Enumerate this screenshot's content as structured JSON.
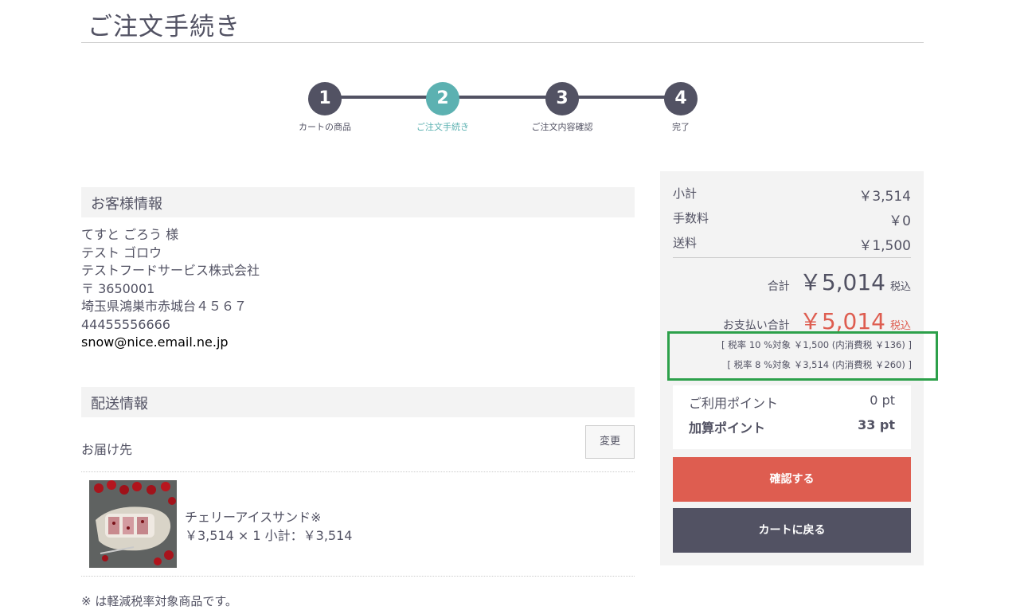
{
  "page": {
    "title": "ご注文手続き"
  },
  "flow": {
    "steps": [
      {
        "number": "1",
        "label": "カートの商品"
      },
      {
        "number": "2",
        "label": "ご注文手続き"
      },
      {
        "number": "3",
        "label": "ご注文内容確認"
      },
      {
        "number": "4",
        "label": "完了"
      }
    ],
    "active_step": 2,
    "active_color": "#5cb1b1",
    "inactive_color": "#525263"
  },
  "customer": {
    "heading": "お客様情報",
    "name_kana_honorific": "てすと ごろう 様",
    "name_katakana": "テスト ゴロウ",
    "company": "テストフードサービス株式会社",
    "postal": "〒 3650001",
    "address": "埼玉県鴻巣市赤城台４５６７",
    "phone": "44455556666",
    "email": "snow@nice.email.ne.jp"
  },
  "shipping": {
    "heading": "配送情報",
    "destination_label": "お届け先",
    "change_button": "変更",
    "item": {
      "image_icon": "product-photo-cherry-ice-sandwich",
      "name": "チェリーアイスサンド※",
      "price_line": "￥3,514 × 1  小計：￥3,514"
    },
    "note": "※ は軽減税率対象商品です。"
  },
  "summary": {
    "subtotal_label": "小計",
    "subtotal_value": "￥3,514",
    "fee_label": "手数料",
    "fee_value": "￥0",
    "shipping_label": "送料",
    "shipping_value": "￥1,500",
    "total_label": "合計",
    "total_value": "￥5,014",
    "total_tax": "税込",
    "payment_label": "お支払い合計",
    "payment_value": "￥5,014",
    "payment_tax": "税込",
    "tax_10": "[ 税率 10 %対象  ￥1,500 (内消費税 ￥136) ]",
    "tax_8": "[ 税率 8 %対象  ￥3,514 (内消費税 ￥260) ]",
    "used_points_label": "ご利用ポイント",
    "used_points_value": "0 pt",
    "added_points_label": "加算ポイント",
    "added_points_value": "33 pt",
    "confirm_button": "確認する",
    "back_button": "カートに戻る",
    "accent_color": "#de5d50",
    "highlight_color": "#2ca04a"
  }
}
